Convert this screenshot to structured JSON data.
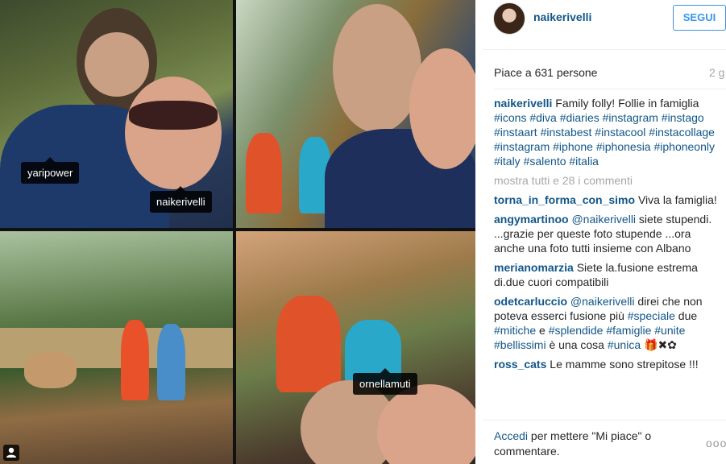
{
  "post": {
    "tags": {
      "t1a": "yaripower",
      "t1b": "naikerivelli",
      "t4a": "ornellamuti"
    }
  },
  "header": {
    "username": "naikerivelli",
    "follow_label": "SEGUI"
  },
  "stats": {
    "likes": "Piace a 631 persone",
    "age": "2 g"
  },
  "caption": {
    "user": "naikerivelli",
    "text": " Family folly! Follie in famiglia ",
    "hashtags": "#icons #diva #diaries #instagram #instago #instaart #instabest #instacool #instacollage #instagram #iphone #iphonesia #iphoneonly #italy #salento #italia"
  },
  "show_all": "mostra tutti e 28 i commenti",
  "comments": [
    {
      "user": "torna_in_forma_con_simo",
      "text": " Viva la famiglia!"
    },
    {
      "user": "angymartinoo",
      "mention": " @naikerivelli",
      "text": " siete stupendi. ...grazie per queste foto stupende ...ora anche una foto tutti insieme con Albano"
    },
    {
      "user": "merianomarzia",
      "text": " Siete la.fusione estrema di.due cuori compatibili"
    },
    {
      "user": "odetcarluccio",
      "mention": " @naikerivelli",
      "text": " direi che non poteva esserci fusione più ",
      "h1": "#speciale",
      "t2": " due ",
      "h2": "#mitiche",
      "t3": " e ",
      "h3": "#splendide",
      "t4": " ",
      "h4": "#famiglie",
      "t5": " ",
      "h5": "#unite",
      "t6": " ",
      "h6": "#bellissimi",
      "t7": " è una cosa ",
      "h7": "#unica",
      "t8": " 🎁✖✿"
    },
    {
      "user": "ross_cats",
      "text": " Le mamme sono strepitose !!!"
    }
  ],
  "footer": {
    "login": "Accedi",
    "text": " per mettere \"Mi piace\" o commentare.",
    "more_label": "ooo"
  }
}
